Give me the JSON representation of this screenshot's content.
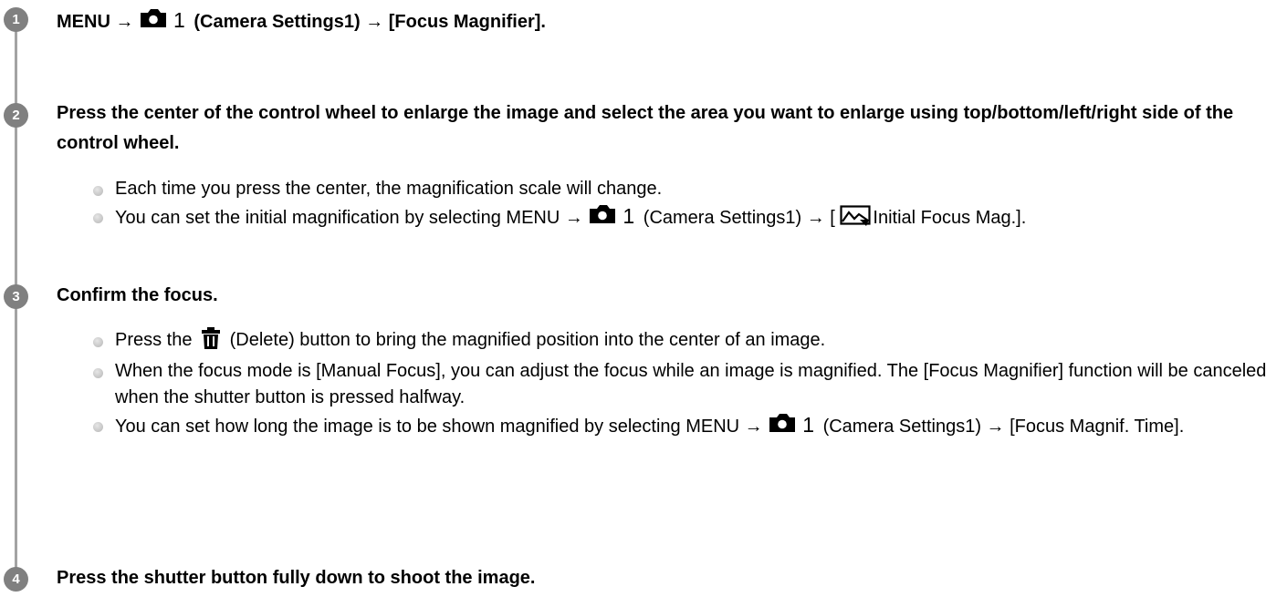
{
  "steps": [
    {
      "number": "1",
      "title_before": "MENU →",
      "title_icon_num": "1",
      "title_after": "(Camera Settings1) → [Focus Magnifier]."
    },
    {
      "number": "2",
      "title": "Press the center of the control wheel to enlarge the image and select the area you want to enlarge using top/bottom/left/right side of the control wheel.",
      "bullets": [
        {
          "text": "Each time you press the center, the magnification scale will change."
        },
        {
          "text_before": "You can set the initial magnification by selecting MENU →",
          "icon_num": "1",
          "text_middle": "(Camera Settings1) → [",
          "text_after": "Initial Focus Mag.]."
        }
      ]
    },
    {
      "number": "3",
      "title": "Confirm the focus.",
      "bullets": [
        {
          "text_before": "Press the",
          "text_after": "(Delete) button to bring the magnified position into the center of an image."
        },
        {
          "text": "When the focus mode is [Manual Focus], you can adjust the focus while an image is magnified. The [Focus Magnifier] function will be canceled when the shutter button is pressed halfway."
        },
        {
          "text_before": "You can set how long the image is to be shown magnified by selecting MENU →",
          "icon_num": "1",
          "text_after": "(Camera Settings1) → [Focus Magnif. Time]."
        }
      ]
    },
    {
      "number": "4",
      "title": "Press the shutter button fully down to shoot the image."
    }
  ],
  "icons": {
    "camera": "camera-settings-icon",
    "trash": "trash-icon",
    "focus_mag": "focus-magnifier-icon"
  },
  "colors": {
    "badge": "#808080",
    "rail": "#a3a3a3",
    "text": "#000000"
  }
}
